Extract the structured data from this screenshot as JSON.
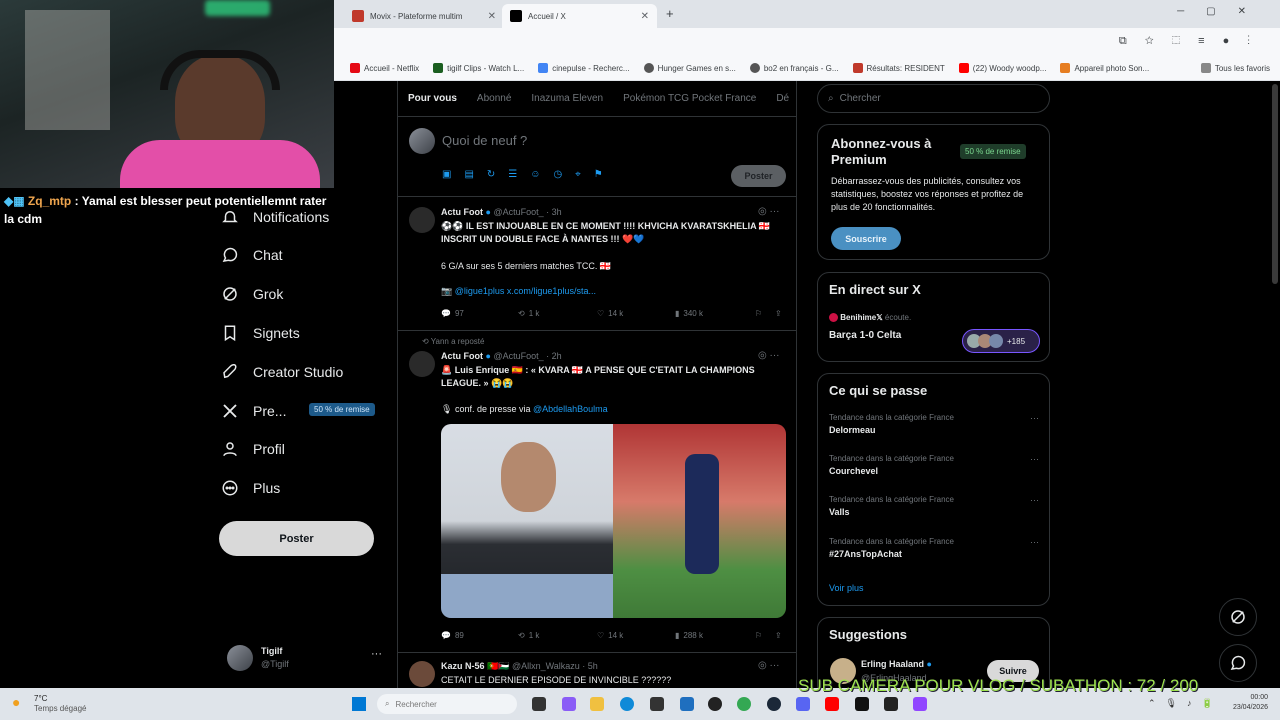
{
  "stream": {
    "chat_user": "Zq_mtp",
    "chat_message": "Yamal est blesser peut potentiellemnt rater la cdm",
    "sub_banner": "SUB CAMERA POUR VLOG / SUBATHON  :  72 / 200"
  },
  "browser": {
    "tabs": [
      {
        "label": "Movix - Plateforme multim",
        "active": false
      },
      {
        "label": "Accueil / X",
        "active": true
      }
    ],
    "bookmarks": [
      "Accueil - Netflix",
      "tigilf Clips - Watch L...",
      "cinepulse - Recherc...",
      "Hunger Games en s...",
      "bo2 en français - G...",
      "Résultats: RESIDENT",
      "(22) Woody woodp...",
      "Appareil photo Son..."
    ],
    "all_bookmarks": "Tous les favoris"
  },
  "nav": {
    "items": [
      "Notifications",
      "Chat",
      "Grok",
      "Signets",
      "Creator Studio",
      "Pre...",
      "Profil",
      "Plus"
    ],
    "premium_badge": "50 % de remise",
    "post_button": "Poster",
    "user_name": "Tigilf",
    "user_handle": "@Tigilf"
  },
  "feed": {
    "tabs": [
      "Pour vous",
      "Abonné",
      "Inazuma Eleven",
      "Pokémon TCG Pocket France",
      "Dé"
    ],
    "compose_placeholder": "Quoi de neuf ?",
    "post_button": "Poster",
    "tweets": [
      {
        "name": "Actu Foot",
        "handle": "@ActuFoot_ · 3h",
        "text1": "⚽⚽ IL EST INJOUABLE EN CE MOMENT !!!! KHVICHA KVARATSKHELIA 🇬🇪 INSCRIT UN DOUBLE FACE À NANTES !!! ❤️💙",
        "text2": "6 G/A sur ses 5 derniers matches TCC. 🇬🇪",
        "text3": "@ligue1plus",
        "link": "x.com/ligue1plus/sta...",
        "replies": "97",
        "reposts": "1 k",
        "likes": "14 k",
        "views": "340 k"
      },
      {
        "reposted_by": "Yann a reposté",
        "name": "Actu Foot",
        "handle": "@ActuFoot_ · 2h",
        "text1": "🚨 Luis Enrique 🇪🇸 : « KVARA 🇬🇪 A PENSE QUE C'ETAIT LA CHAMPIONS LEAGUE. » 😭😭",
        "text2": "conf. de presse via",
        "mention": "@AbdellahBoulma",
        "replies": "89",
        "reposts": "1 k",
        "likes": "14 k",
        "views": "288 k"
      },
      {
        "name": "Kazu N-56 🇵🇹🇵🇸",
        "handle": "@Allxn_Walkazu · 5h",
        "text1": "CETAIT LE DERNIER EPISODE DE INVINCIBLE ??????"
      }
    ]
  },
  "sidebar": {
    "search_placeholder": "Chercher",
    "premium_title": "Abonnez-vous à Premium",
    "premium_badge": "50 % de remise",
    "premium_text": "Débarrassez-vous des publicités, consultez vos statistiques, boostez vos réponses et profitez de plus de 20 fonctionnalités.",
    "subscribe": "Souscrire",
    "live_title": "En direct sur X",
    "live_host": "Benihime𝕏",
    "live_listening": "écoute.",
    "live_event": "Barça 1-0 Celta",
    "live_count": "+185",
    "trends_title": "Ce qui se passe",
    "trends": [
      {
        "cat": "Tendance dans la catégorie France",
        "name": "Delormeau"
      },
      {
        "cat": "Tendance dans la catégorie France",
        "name": "Courchevel"
      },
      {
        "cat": "Tendance dans la catégorie France",
        "name": "Valls"
      },
      {
        "cat": "Tendance dans la catégorie France",
        "name": "#27AnsTopAchat"
      }
    ],
    "see_more": "Voir plus",
    "suggestions_title": "Suggestions",
    "suggestion_name": "Erling Haaland",
    "suggestion_handle": "@ErlingHaaland",
    "follow": "Suivre"
  },
  "taskbar": {
    "weather_temp": "7°C",
    "weather_desc": "Temps dégagé",
    "search_placeholder": "Rechercher",
    "time": "00:00",
    "date": "23/04/2026"
  },
  "colors": {
    "accent": "#1d9bf0",
    "green_badge": "#1f3d2a"
  }
}
